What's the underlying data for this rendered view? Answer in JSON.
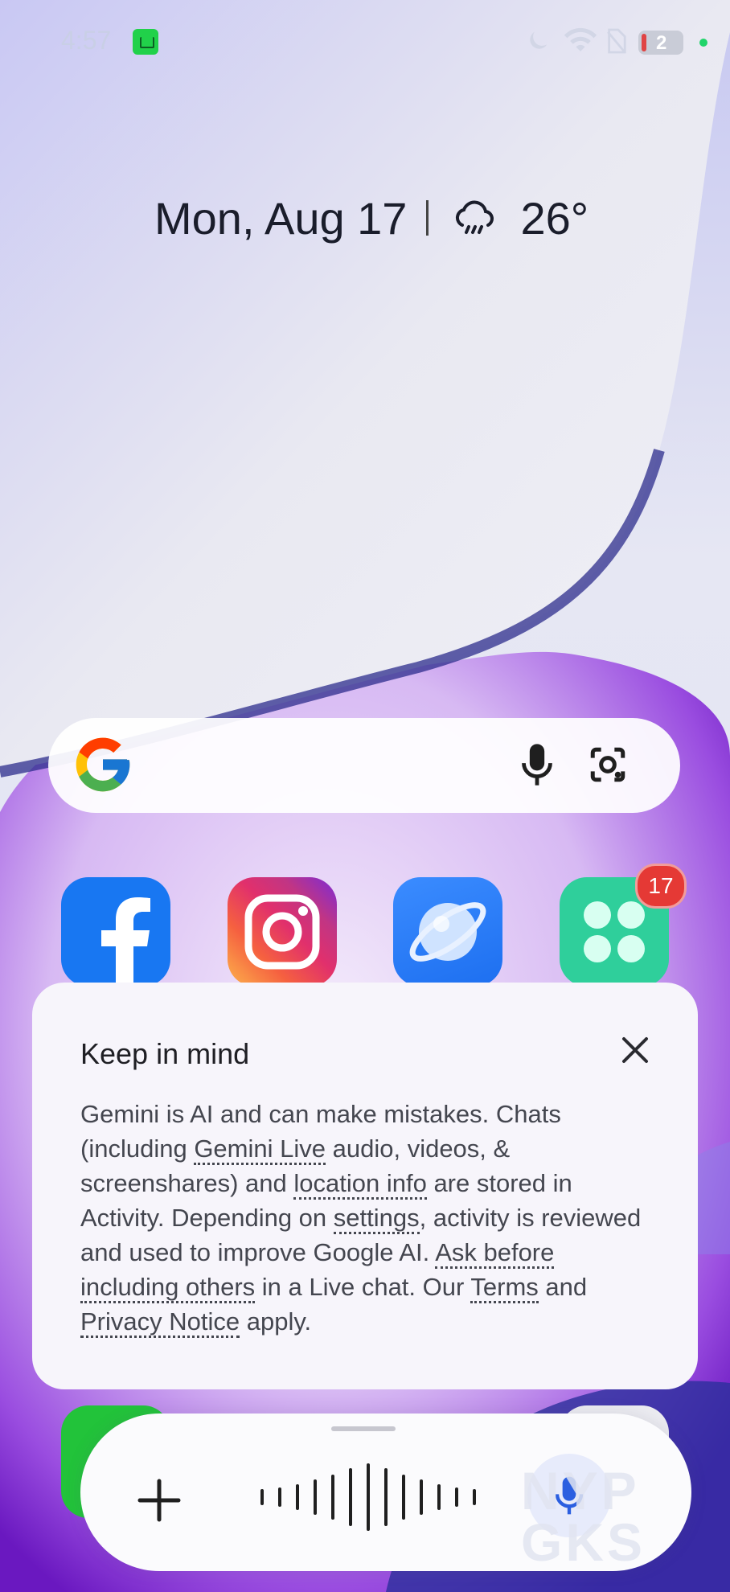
{
  "status_bar": {
    "time": "4:57",
    "battery": "2"
  },
  "home": {
    "date": "Mon, Aug 17",
    "temperature": "26°",
    "weather_icon": "rain-cloud-icon"
  },
  "search_bar": {
    "icons": [
      "google-logo",
      "mic-icon",
      "lens-icon"
    ]
  },
  "apps": [
    {
      "name": "Facebook",
      "icon": "facebook-icon"
    },
    {
      "name": "Instagram",
      "icon": "instagram-icon"
    },
    {
      "name": "Browser",
      "icon": "browser-icon"
    },
    {
      "name": "App Market",
      "icon": "app-market-icon",
      "badge": "17"
    }
  ],
  "dialog": {
    "title": "Keep in mind",
    "t1": "Gemini is AI and can make mistakes. Chats (including ",
    "l1": "Gemini Live",
    "t2": " audio, videos, & screenshares) and ",
    "l2": "location info",
    "t3": " are stored in Activity. Depending on ",
    "l3": "settings",
    "t4": ", activity is reviewed and used to improve Google AI. ",
    "l4": "Ask before including others",
    "t5": " in a Live chat. Our ",
    "l5": "Terms",
    "t6": " and ",
    "l6": "Privacy Notice",
    "t7": " apply."
  },
  "watermark": {
    "line1": "NYP",
    "line2": "GKS"
  },
  "colors": {
    "accent_purple": "#8a35d6",
    "dialog_bg": "#f7f5fb",
    "badge_red": "#e53935"
  }
}
